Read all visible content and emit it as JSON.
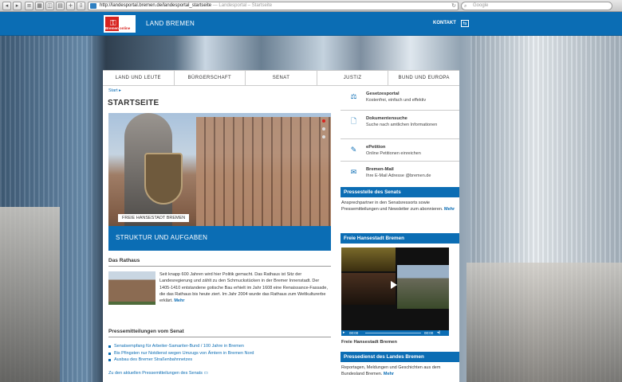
{
  "browser": {
    "url": "http://landesportal.bremen.de/landesportal_startseite",
    "page_title": "— Landesportal – Startseite",
    "search_placeholder": "Google"
  },
  "header": {
    "logo_text_left": "Bremen",
    "logo_text_right": "online",
    "site_name": "LAND BREMEN",
    "contact_label": "KONTAKT"
  },
  "mainnav": [
    "LAND UND LEUTE",
    "BÜRGERSCHAFT",
    "SENAT",
    "JUSTIZ",
    "BUND UND EUROPA"
  ],
  "breadcrumb": "Start ▸",
  "page_title": "STARTSEITE",
  "hero": {
    "tag": "FREIE HANSESTADT BREMEN",
    "caption": "STRUKTUR UND AUFGABEN"
  },
  "rathaus": {
    "heading": "Das Rathaus",
    "text": "Seit knapp 600 Jahren wird hier Politik gemacht. Das Rathaus ist Sitz der Landesregierung und zählt zu den Schmuckstücken in der Bremer Innenstadt. Der 1405-1410 entstandene gotische Bau erhielt im Jahr 1608 eine Renaissance-Fassade, die das Rathaus bis heute ziert. Im Jahr 2004 wurde das Rathaus zum Weltkulturerbe erklärt.",
    "more": "Mehr"
  },
  "press": {
    "heading": "Pressemitteilungen vom Senat",
    "items": [
      "Senatsempfang für Arbeiter-Samariter-Bund / 100 Jahre in Bremen",
      "Bis Pfingsten nur Notdienst wegen Umzugs von Ämtern in Bremen Nord",
      "Ausbau des Bremer Straßenbahnnetzes"
    ],
    "more_link": "Zu den aktuellen Pressemitteilungen des Senats"
  },
  "services": [
    {
      "icon": "scales-icon",
      "title": "Gesetzesportal",
      "desc": "Kostenfrei, einfach und effektiv"
    },
    {
      "icon": "document-icon",
      "title": "Dokumentensuche",
      "desc": "Suche nach amtlichen Informationen"
    },
    {
      "icon": "pen-icon",
      "title": "ePetition",
      "desc": "Online Petitionen einreichen"
    },
    {
      "icon": "mail-icon",
      "title": "Bremen-Mail",
      "desc": "Ihre E-Mail Adresse @bremen.de"
    }
  ],
  "pressestelle": {
    "heading": "Pressestelle des Senats",
    "text": "Ansprechpartner in den Senatsressorts sowie Pressemitteilungen und Newsletter zum abonnieren.",
    "more": "Mehr"
  },
  "video": {
    "heading": "Freie Hansestadt Bremen",
    "time_current": "00:00",
    "time_total": "00:00",
    "caption": "Freie Hansestadt Bremen"
  },
  "pressedienst": {
    "heading": "Pressedienst des Landes Bremen",
    "text": "Reportagen, Meldungen und Geschichten aus dem Bundesland Bremen.",
    "more": "Mehr"
  }
}
